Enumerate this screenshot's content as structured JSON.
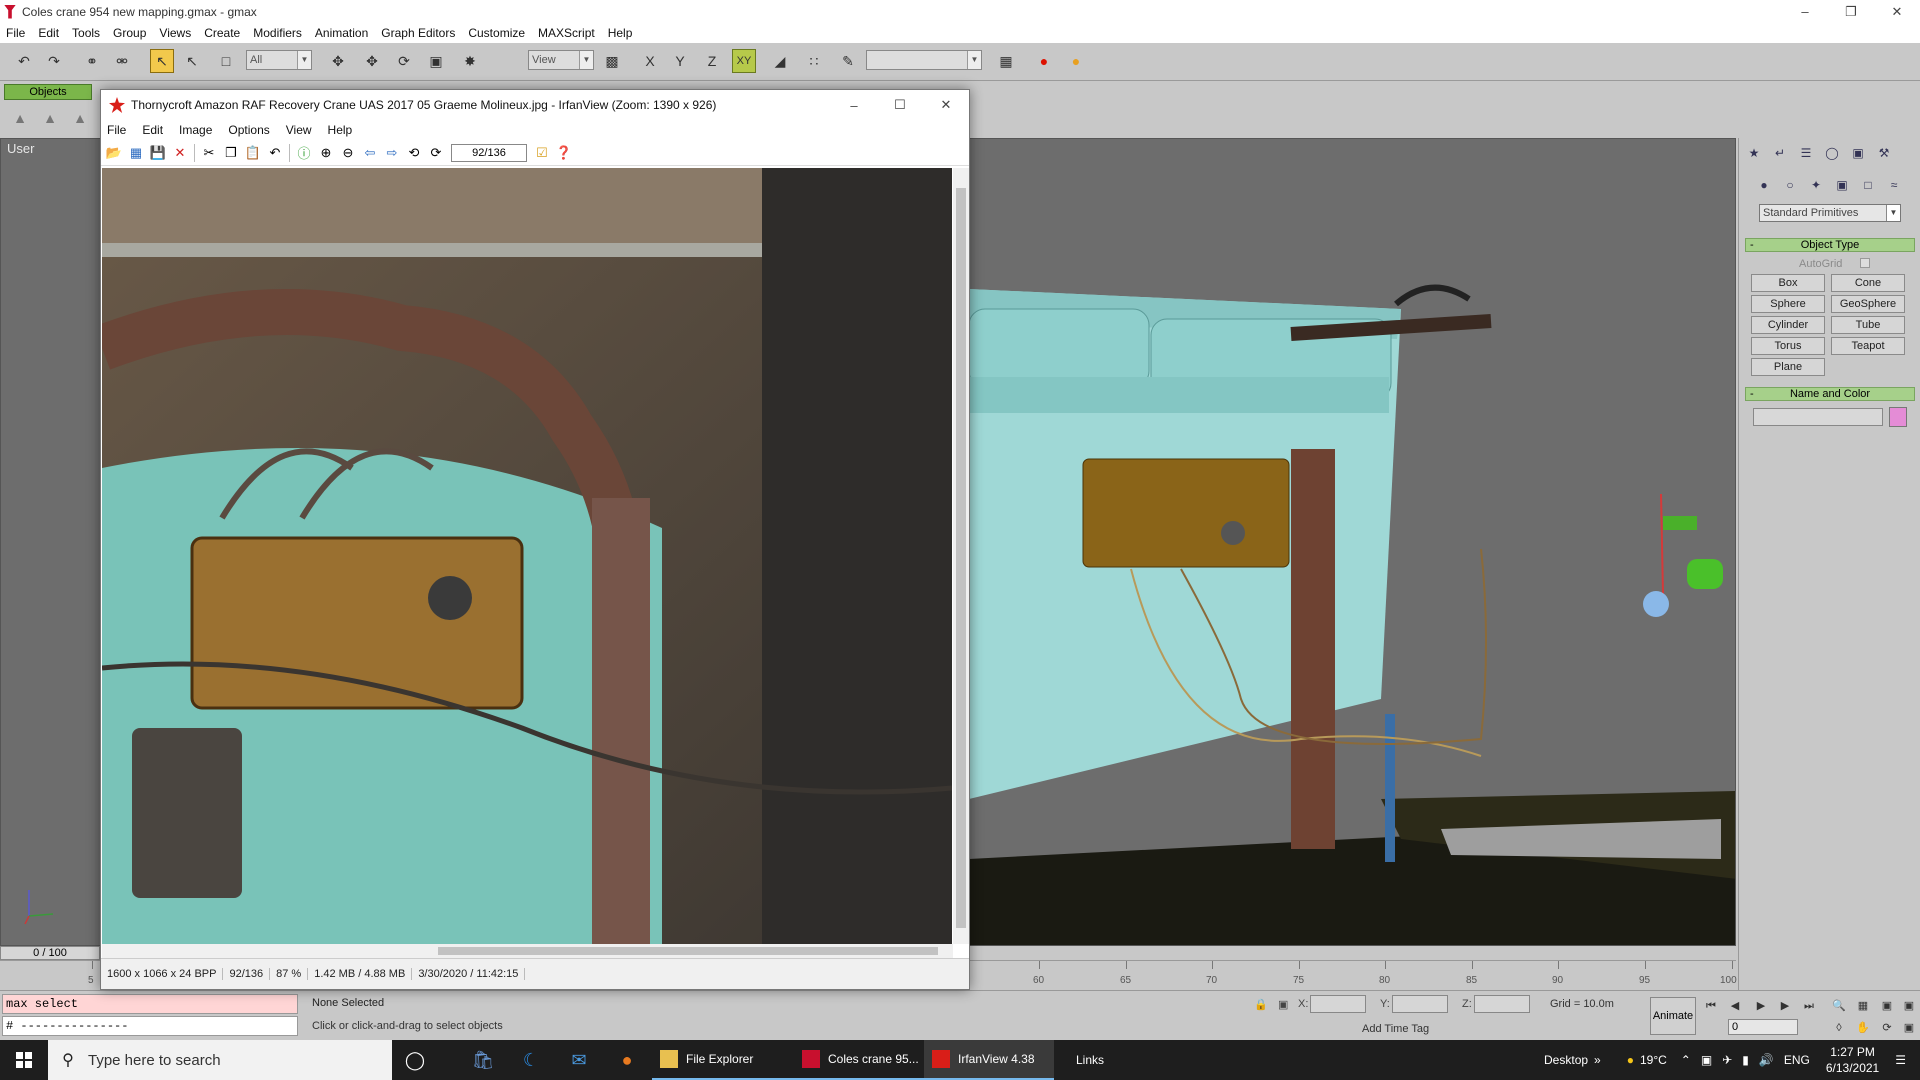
{
  "gmax": {
    "title": "Coles crane 954 new mapping.gmax - gmax",
    "menu": [
      "File",
      "Edit",
      "Tools",
      "Group",
      "Views",
      "Create",
      "Modifiers",
      "Animation",
      "Graph Editors",
      "Customize",
      "MAXScript",
      "Help"
    ],
    "toolbar": {
      "selection_filter": "All",
      "ref_coord": "View",
      "axis_x": "X",
      "axis_y": "Y",
      "axis_z": "Z",
      "axis_xy": "XY"
    },
    "command_tab": "Objects",
    "viewport_label": "User",
    "command_panel": {
      "primitive_type": "Standard Primitives",
      "object_type_title": "Object Type",
      "autogrid_label": "AutoGrid",
      "primitives": [
        "Box",
        "Cone",
        "Sphere",
        "GeoSphere",
        "Cylinder",
        "Tube",
        "Torus",
        "Teapot",
        "Plane"
      ],
      "name_color_title": "Name and Color",
      "swatch_color": "#e48cd6"
    },
    "time_slider": "0 / 100",
    "track_ticks": [
      "5",
      "60",
      "65",
      "70",
      "75",
      "80",
      "85",
      "90",
      "95",
      "100"
    ],
    "status": {
      "maxscript_line1": "max select",
      "maxscript_line2": "# ---------------",
      "selection": "None Selected",
      "prompt": "Click or click-and-drag to select objects",
      "x_label": "X:",
      "y_label": "Y:",
      "z_label": "Z:",
      "grid": "Grid = 10.0m",
      "add_time_tag": "Add Time Tag",
      "animate": "Animate",
      "frame": "0"
    }
  },
  "irfanview": {
    "title": "Thornycroft Amazon RAF Recovery Crane UAS 2017 05 Graeme Molineux.jpg - IrfanView (Zoom: 1390 x 926)",
    "menu": [
      "File",
      "Edit",
      "Image",
      "Options",
      "View",
      "Help"
    ],
    "page_counter": "92/136",
    "status": [
      "1600 x 1066 x 24 BPP",
      "92/136",
      "87 %",
      "1.42 MB / 4.88 MB",
      "3/30/2020 / 11:42:15"
    ]
  },
  "taskbar": {
    "search_placeholder": "Type here to search",
    "tasks": [
      "File Explorer",
      "Coles crane 95...",
      "IrfanView 4.38"
    ],
    "links": "Links",
    "desktop": "Desktop",
    "weather": "19°C",
    "language": "ENG",
    "time": "1:27 PM",
    "date": "6/13/2021"
  }
}
